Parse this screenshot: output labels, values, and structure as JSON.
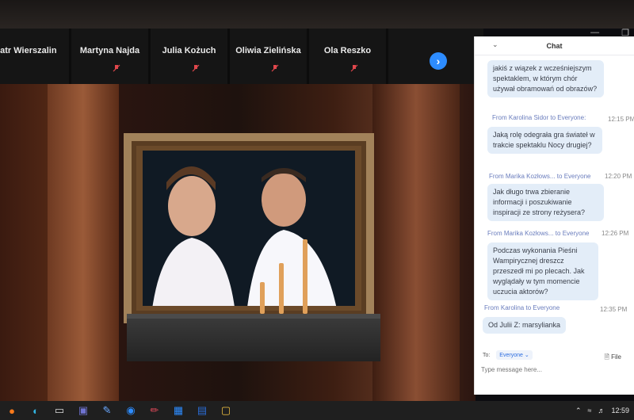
{
  "participants": [
    {
      "name": "eatr Wierszalin",
      "muted": false
    },
    {
      "name": "Martyna Najda",
      "muted": true
    },
    {
      "name": "Julia Kożuch",
      "muted": true
    },
    {
      "name": "Oliwia Zielińska",
      "muted": true
    },
    {
      "name": "Ola Reszko",
      "muted": true
    }
  ],
  "next_button_icon": "chevron-right-icon",
  "chat": {
    "title": "Chat",
    "messages": [
      {
        "from": "",
        "to": "",
        "time": "",
        "text": "jakiś z wiązek z wcześniejszym spektaklem, w którym chór używał obramowań od obrazów?"
      },
      {
        "from": "From Karolina Sidor",
        "to": "Everyone",
        "time": "12:15 PM",
        "text": "Jaką rolę odegrała gra świateł w trakcie spektaklu Nocy drugiej?"
      },
      {
        "from": "From Marika Kozłows...",
        "to": "Everyone",
        "time": "12:20 PM",
        "text": "Jak długo trwa zbieranie informacji i poszukiwanie inspiracji ze strony reżysera?"
      },
      {
        "from": "From Marika Kozłows...",
        "to": "Everyone",
        "time": "12:26 PM",
        "text": "Podczas wykonania Pieśni Wampirycznej dreszcz przeszedł mi po plecach. Jak wyglądały w tym momencie uczucia aktorów?"
      },
      {
        "from": "From Karolina",
        "to": "Everyone",
        "time": "12:35 PM",
        "text": "Od Julii Z: marsylianka"
      }
    ],
    "to_label": "To:",
    "recipient": "Everyone",
    "file_label": "File",
    "input_placeholder": "Type message here..."
  },
  "taskbar": {
    "icons": [
      "firefox-icon",
      "edge-icon",
      "monitor-icon",
      "teams-icon",
      "snip-icon",
      "zoom-icon",
      "pen-icon",
      "chart-icon",
      "word-icon",
      "folder-icon"
    ],
    "time": "12:59"
  },
  "colors": {
    "accent": "#2d8cff",
    "chat_bubble": "#e3edf8",
    "chat_meta": "#6a7dbd",
    "muted_mic": "#e0474c"
  }
}
